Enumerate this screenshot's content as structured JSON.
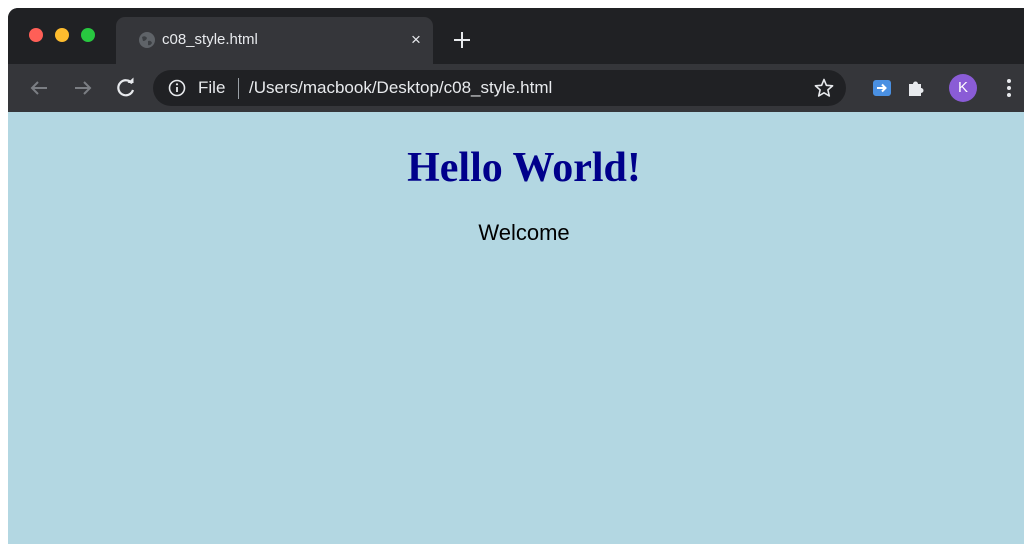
{
  "window": {
    "controls": [
      "close",
      "minimize",
      "zoom"
    ]
  },
  "tab": {
    "title": "c08_style.html",
    "close_label": "×",
    "favicon": "globe-icon"
  },
  "toolbar": {
    "back_icon": "back-arrow-icon",
    "forward_icon": "forward-arrow-icon",
    "reload_icon": "reload-icon",
    "bookmark_icon": "star-icon",
    "extensions": [
      "extension-icon",
      "puzzle-icon"
    ],
    "menu_icon": "more-vert-icon"
  },
  "omnibox": {
    "scheme": "File",
    "url": "/Users/macbook/Desktop/c08_style.html"
  },
  "profile": {
    "initial": "K",
    "color": "#8a5cd6"
  },
  "page": {
    "heading": "Hello World!",
    "text": "Welcome",
    "background": "#b3d7e2",
    "heading_color": "#00008b"
  }
}
